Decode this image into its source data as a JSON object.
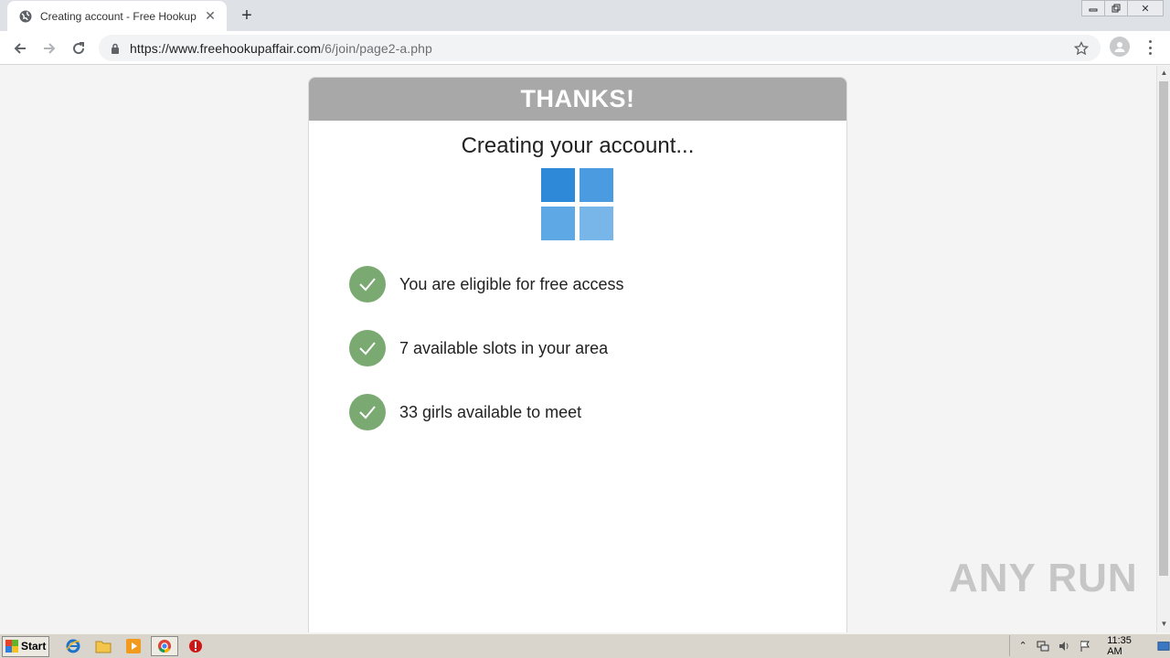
{
  "browser": {
    "tab_title": "Creating account - Free Hookup Affair",
    "url_host": "https://www.freehookupaffair.com",
    "url_path": "/6/join/page2-a.php"
  },
  "page": {
    "header": "THANKS!",
    "subtitle": "Creating your account...",
    "checklist": [
      {
        "text": "You are eligible for free access"
      },
      {
        "text": "7 available slots in your area"
      },
      {
        "text": "33 girls available to meet"
      }
    ],
    "accent_colors": {
      "header_bg": "#a8a8a8",
      "check_green": "#7aaa72",
      "loader_blue": "#2e8ad8"
    }
  },
  "watermark": "ANY RUN",
  "taskbar": {
    "start_label": "Start",
    "clock": "11:35 AM"
  }
}
